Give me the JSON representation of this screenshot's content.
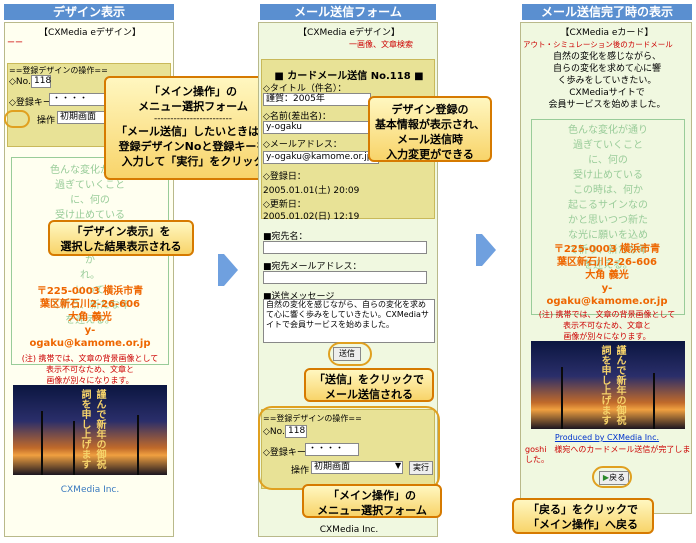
{
  "panel1": {
    "header": "デザイン表示",
    "title": "【CXMedia eデザイン】",
    "dashes": "ーー",
    "ops_heading": "==登録デザインの操作==",
    "no_label": "◇No.",
    "no_value": "118",
    "key_label": "◇登録キー",
    "key_value": "・・・・",
    "op_label": "操作",
    "op_value": "初期画面",
    "poem": [
      "色んな変化が通り",
      "過ぎていくこと",
      "に、何の",
      "受け止めている",
      "この時は、何か",
      "起こるサイン",
      "か",
      "れ。",
      "いって",
      "て祈り、新たな年",
      "を迎える。"
    ],
    "address": [
      "〒225-0003 横浜市青",
      "葉区新石川2-26-606",
      "大角 義光",
      "y-",
      "ogaku@kamome.or.jp"
    ],
    "note": [
      "(注) 携帯では、文章の背景画像として",
      "表示不可なため、文章と",
      "画像が別々になります。"
    ],
    "footer": "CXMedia Inc.",
    "callout_top": [
      "「メイン操作」の",
      "メニュー選択フォーム",
      "------------------------",
      "「メール送信」したいときは、",
      "登録デザインNoと登録キーを",
      "入力して「実行」をクリック"
    ],
    "callout_mid": [
      "「デザイン表示」を",
      "選択した結果表示される"
    ]
  },
  "panel2": {
    "header": "メール送信フォーム",
    "title": "【CXMedia eデザイン】",
    "subnote": "一画像、文章検索",
    "card_title": "■ カードメール送信 No.118 ■",
    "title_label": "◇タイトル（件名）：",
    "title_value": "謹賀：2005年",
    "sender_label": "◇名前(差出名)：",
    "sender_value": "y-ogaku",
    "mail_label": "◇メールアドレス：",
    "mail_value": "y-ogaku@kamome.or.jp",
    "reg_label": "◇登録日：",
    "reg_value": "2005.01.01(土) 20:09",
    "upd_label": "◇更新日：",
    "upd_value": "2005.01.02(日) 12:19",
    "to_name_label": "■宛先名：",
    "to_mail_label": "■宛先メールアドレス：",
    "msg_label": "■送信メッセージ",
    "msg_value": "自然の変化を感じながら、自らの変化を求めて心に響く歩みをしていきたい。CXMediaサイトで会員サービスを始めました。",
    "send_button": "送信",
    "ops_heading": "==登録デザインの操作==",
    "no_label": "◇No.",
    "no_value": "118",
    "key_label": "◇登録キー",
    "key_value": "・・・・",
    "op_label": "操作",
    "op_value": "初期画面",
    "exec_button": "実行",
    "footer": "CXMedia Inc.",
    "callout_info": [
      "デザイン登録の",
      "基本情報が表示され、",
      "メール送信時",
      "入力変更ができる"
    ],
    "callout_send": [
      "「送信」をクリックで",
      "メール送信される"
    ],
    "callout_menu": [
      "「メイン操作」の",
      "メニュー選択フォーム"
    ]
  },
  "panel3": {
    "header": "メール送信完了時の表示",
    "title": "【CXMedia eカード】",
    "subnote": "アウト・シミュレーション後のカードメール",
    "message": [
      "自然の変化を感じながら、",
      "自らの変化を求めて心に響",
      "く歩みをしていきたい。",
      "CXMediaサイトで",
      "会員サービスを始めました。"
    ],
    "poem": [
      "色んな変化が通り",
      "過ぎていくこと",
      "に、何の",
      "受け止めている",
      "この時は、何か",
      "起こるサインなの",
      "かと思いつつ新た",
      "な光に願いを込め",
      "て祈り、新たな年",
      "を迎える。"
    ],
    "address": [
      "〒225-0003 横浜市青",
      "葉区新石川2-26-606",
      "大角 義光",
      "y-",
      "ogaku@kamome.or.jp"
    ],
    "note": [
      "(注) 携帯では、文章の背景画像として",
      "表示不可なため、文章と",
      "画像が別々になります。"
    ],
    "produced_by": "Produced by CXMedia Inc.",
    "sent_msg": "goshi　様宛へのカードメール送信が完了しました。",
    "back_button": "戻る",
    "callout_back": [
      "「戻る」をクリックで",
      "「メイン操作」へ戻る"
    ]
  },
  "photo_calligraphy": "謹んで新年の御祝詞を申し上げます",
  "colors": {
    "header_blue": "#5a8fd0",
    "band": "#e8e296",
    "callout": "#f8d46a",
    "poem": "#99cc99",
    "address": "#ee6600"
  }
}
